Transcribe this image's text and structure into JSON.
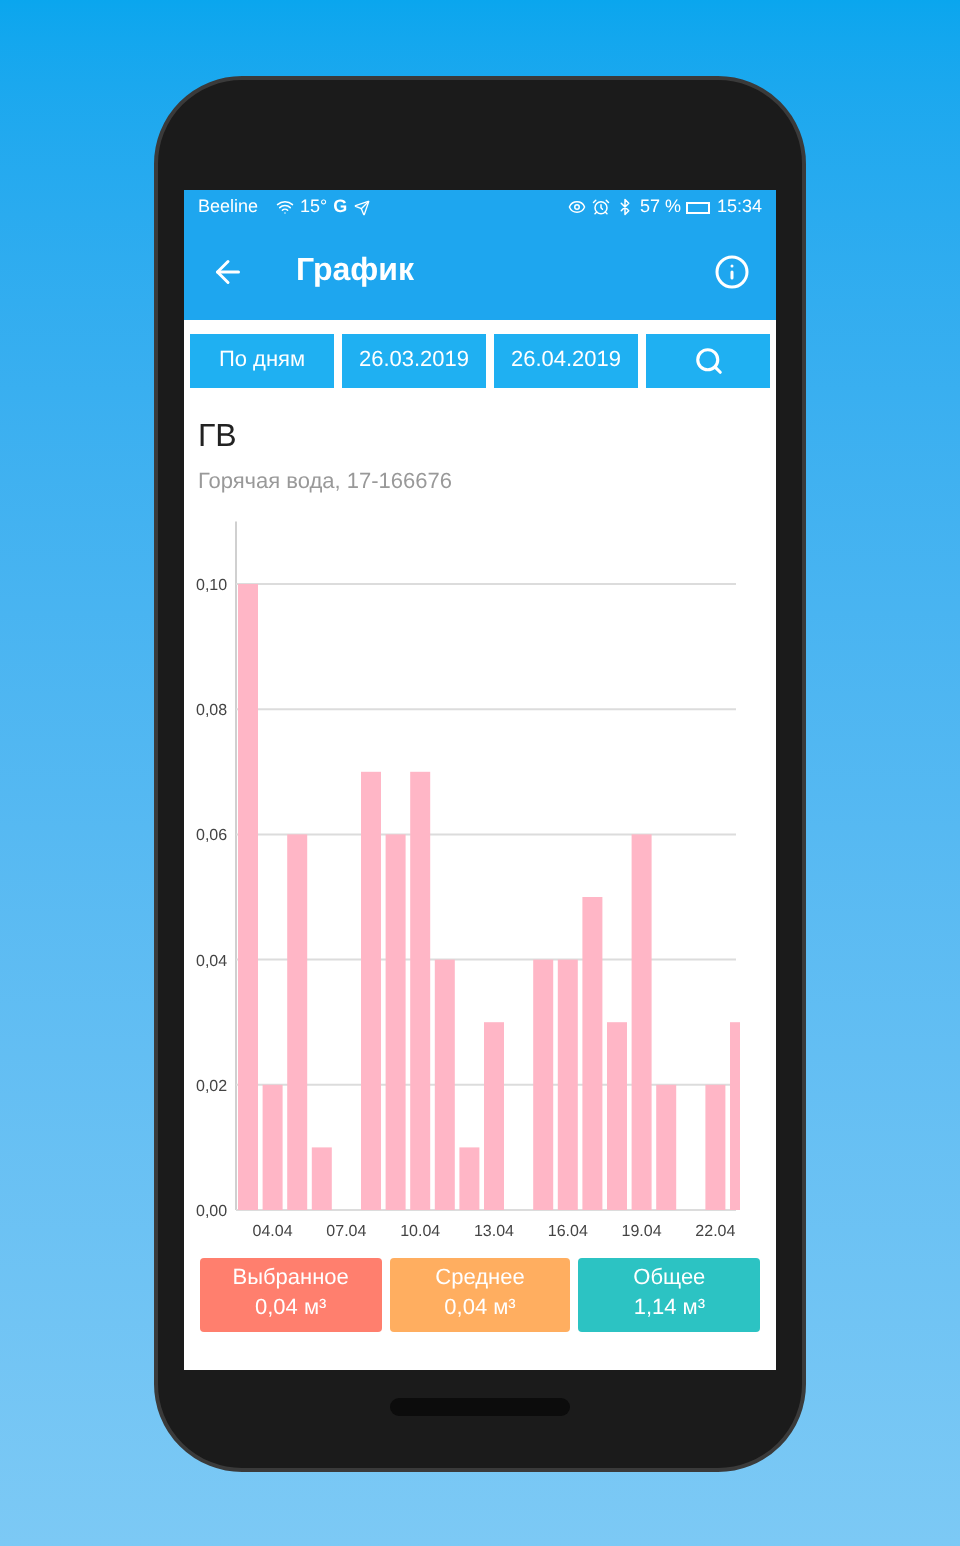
{
  "status_bar": {
    "carrier": "Beeline",
    "temperature": "15°",
    "network": "G",
    "battery": "57 %",
    "time": "15:34"
  },
  "app_bar": {
    "title": "График"
  },
  "filters": [
    {
      "kind": "text",
      "label": "По дням"
    },
    {
      "kind": "text",
      "label": "26.03.2019"
    },
    {
      "kind": "text",
      "label": "26.04.2019"
    },
    {
      "kind": "search"
    }
  ],
  "meter": {
    "title": "ГВ",
    "subtitle": "Горячая вода, 17-166676"
  },
  "chart_data": {
    "type": "bar",
    "color": "#ffb6c6",
    "categories": [
      null,
      "04.04",
      null,
      null,
      "07.04",
      null,
      null,
      "10.04",
      null,
      null,
      "13.04",
      null,
      null,
      "16.04",
      null,
      null,
      "19.04",
      null,
      null,
      "22.04",
      null
    ],
    "values": [
      0.1,
      0.02,
      0.06,
      0.01,
      0,
      0.07,
      0.06,
      0.07,
      0.04,
      0.01,
      0.03,
      0,
      0.04,
      0.04,
      0.05,
      0.03,
      0.06,
      0.02,
      0,
      0.02,
      0.03
    ],
    "ylim": [
      0,
      0.11
    ],
    "grid": true,
    "yticks": [
      {
        "value": 0,
        "label": "0,00"
      },
      {
        "value": 0.02,
        "label": "0,02"
      },
      {
        "value": 0.04,
        "label": "0,04"
      },
      {
        "value": 0.06,
        "label": "0,06"
      },
      {
        "value": 0.08,
        "label": "0,08"
      },
      {
        "value": 0.1,
        "label": "0,10"
      }
    ]
  },
  "summary": [
    {
      "label": "Выбранное",
      "value": "0,04 м³",
      "color": "#ff7f6e"
    },
    {
      "label": "Среднее",
      "value": "0,04 м³",
      "color": "#ffae60"
    },
    {
      "label": "Общее",
      "value": "1,14 м³",
      "color": "#2cc3c3"
    }
  ]
}
